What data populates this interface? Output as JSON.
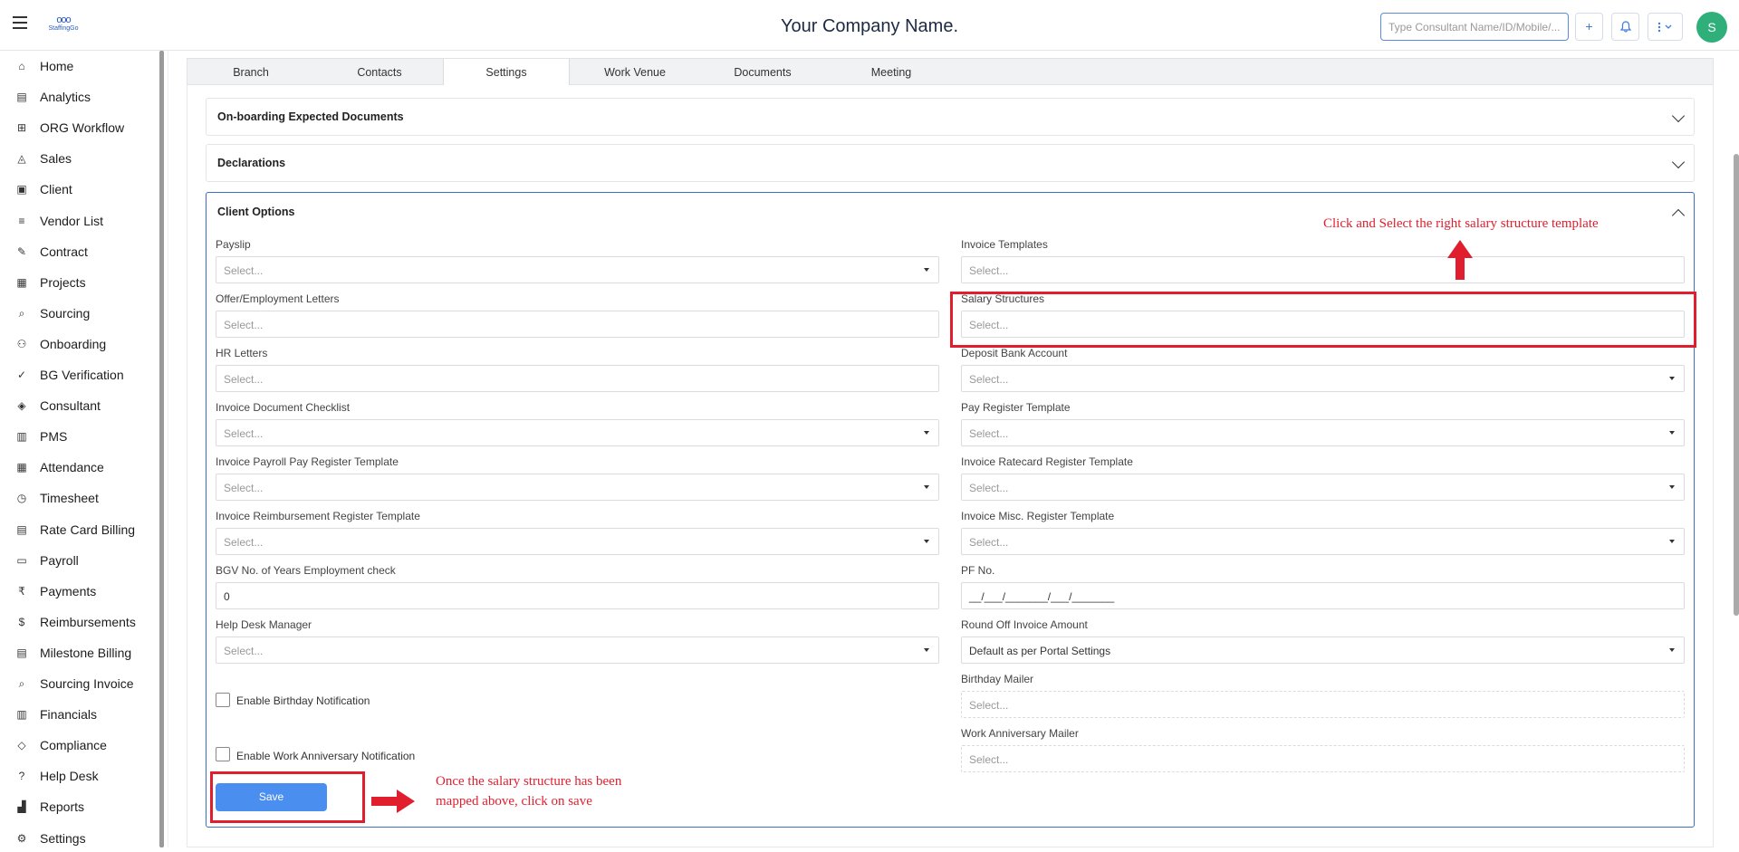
{
  "header": {
    "company_name": "Your Company Name.",
    "logo_text": "StaffingGo",
    "search_placeholder": "Type Consultant Name/ID/Mobile/...",
    "add_button": "+",
    "avatar_letter": "S"
  },
  "sidebar": {
    "items": [
      {
        "label": "Home",
        "icon": "home-icon"
      },
      {
        "label": "Analytics",
        "icon": "analytics-icon"
      },
      {
        "label": "ORG Workflow",
        "icon": "workflow-icon"
      },
      {
        "label": "Sales",
        "icon": "sales-icon"
      },
      {
        "label": "Client",
        "icon": "client-icon"
      },
      {
        "label": "Vendor List",
        "icon": "vendor-icon"
      },
      {
        "label": "Contract",
        "icon": "contract-icon"
      },
      {
        "label": "Projects",
        "icon": "projects-icon"
      },
      {
        "label": "Sourcing",
        "icon": "sourcing-icon"
      },
      {
        "label": "Onboarding",
        "icon": "onboarding-icon"
      },
      {
        "label": "BG Verification",
        "icon": "verification-icon"
      },
      {
        "label": "Consultant",
        "icon": "consultant-icon"
      },
      {
        "label": "PMS",
        "icon": "pms-icon"
      },
      {
        "label": "Attendance",
        "icon": "attendance-icon"
      },
      {
        "label": "Timesheet",
        "icon": "timesheet-icon"
      },
      {
        "label": "Rate Card Billing",
        "icon": "ratecard-icon"
      },
      {
        "label": "Payroll",
        "icon": "payroll-icon"
      },
      {
        "label": "Payments",
        "icon": "rupee-icon"
      },
      {
        "label": "Reimbursements",
        "icon": "reimbursement-icon"
      },
      {
        "label": "Milestone Billing",
        "icon": "milestone-icon"
      },
      {
        "label": "Sourcing Invoice",
        "icon": "invoice-icon"
      },
      {
        "label": "Financials",
        "icon": "financials-icon"
      },
      {
        "label": "Compliance",
        "icon": "compliance-icon"
      },
      {
        "label": "Help Desk",
        "icon": "help-icon"
      },
      {
        "label": "Reports",
        "icon": "reports-icon"
      },
      {
        "label": "Settings",
        "icon": "settings-icon"
      }
    ]
  },
  "tabs": [
    "Branch",
    "Contacts",
    "Settings",
    "Work Venue",
    "Documents",
    "Meeting"
  ],
  "active_tab": "Settings",
  "sections": {
    "onboarding": "On-boarding Expected Documents",
    "declarations": "Declarations",
    "client_options": "Client Options"
  },
  "form": {
    "payslip": {
      "label": "Payslip",
      "placeholder": "Select..."
    },
    "invoice_templates": {
      "label": "Invoice Templates",
      "placeholder": "Select..."
    },
    "offer_letters": {
      "label": "Offer/Employment Letters",
      "placeholder": "Select..."
    },
    "salary_structures": {
      "label": "Salary Structures",
      "placeholder": "Select..."
    },
    "hr_letters": {
      "label": "HR Letters",
      "placeholder": "Select..."
    },
    "deposit_bank": {
      "label": "Deposit Bank Account",
      "placeholder": "Select..."
    },
    "invoice_checklist": {
      "label": "Invoice Document Checklist",
      "placeholder": "Select..."
    },
    "pay_register": {
      "label": "Pay Register Template",
      "placeholder": "Select..."
    },
    "invoice_payroll": {
      "label": "Invoice Payroll Pay Register Template",
      "placeholder": "Select..."
    },
    "invoice_ratecard": {
      "label": "Invoice Ratecard Register Template",
      "placeholder": "Select..."
    },
    "invoice_reimb": {
      "label": "Invoice Reimbursement Register Template",
      "placeholder": "Select..."
    },
    "invoice_misc": {
      "label": "Invoice Misc. Register Template",
      "placeholder": "Select..."
    },
    "bgv_years": {
      "label": "BGV No. of Years Employment check",
      "value": "0"
    },
    "pf_no": {
      "label": "PF No.",
      "value": "__/___/_______/___/_______"
    },
    "help_desk": {
      "label": "Help Desk Manager",
      "placeholder": "Select..."
    },
    "round_off": {
      "label": "Round Off Invoice Amount",
      "value": "Default as per Portal Settings"
    },
    "birthday_notif": {
      "label": "Enable Birthday Notification"
    },
    "birthday_mailer": {
      "label": "Birthday Mailer",
      "placeholder": "Select..."
    },
    "anniversary_notif": {
      "label": "Enable Work Anniversary Notification"
    },
    "anniversary_mailer": {
      "label": "Work Anniversary Mailer",
      "placeholder": "Select..."
    },
    "save": "Save"
  },
  "annotations": {
    "top": "Click and Select the right salary structure template",
    "bottom_line1": "Once the salary structure has been",
    "bottom_line2": "mapped above, click on save"
  },
  "colors": {
    "annotation": "#e01e2e",
    "save_button": "#4a8ef0",
    "avatar": "#2fb07a",
    "accent": "#3b6fbf"
  }
}
